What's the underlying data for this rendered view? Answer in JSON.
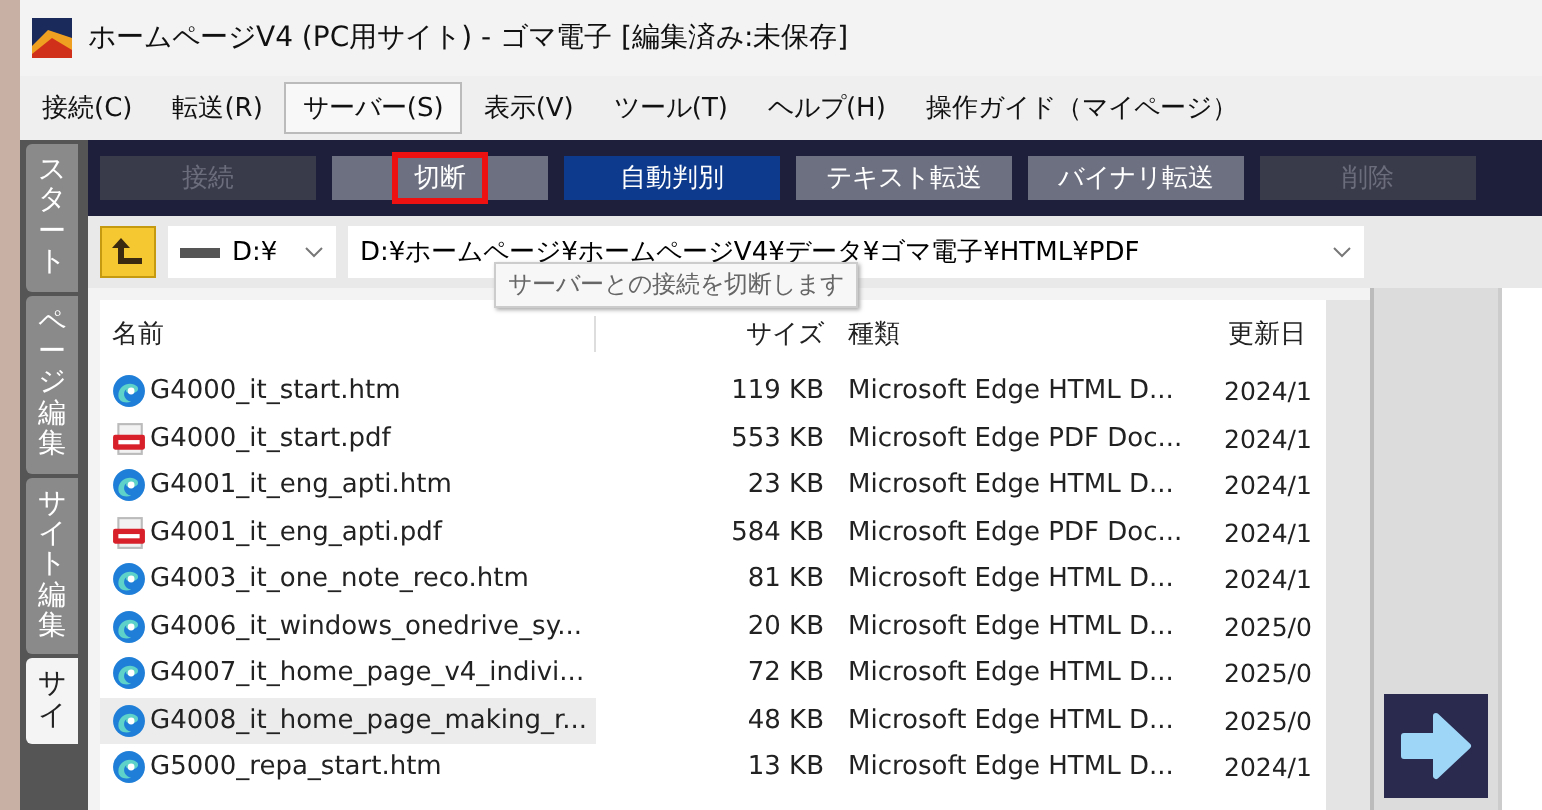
{
  "window": {
    "title": "ホームページV4 (PC用サイト) - ゴマ電子 [編集済み:未保存]"
  },
  "menu": [
    {
      "label": "接続(C)",
      "selected": false
    },
    {
      "label": "転送(R)",
      "selected": false
    },
    {
      "label": "サーバー(S)",
      "selected": true
    },
    {
      "label": "表示(V)",
      "selected": false
    },
    {
      "label": "ツール(T)",
      "selected": false
    },
    {
      "label": "ヘルプ(H)",
      "selected": false
    },
    {
      "label": "操作ガイド（マイページ）",
      "selected": false
    }
  ],
  "side_tabs": [
    {
      "label": "スタート",
      "selected": false
    },
    {
      "label": "ページ編集",
      "selected": false
    },
    {
      "label": "サイト編集",
      "selected": false
    },
    {
      "label": "サイ",
      "selected": true
    }
  ],
  "toolbar": [
    {
      "label": "接続",
      "disabled": true,
      "selected": false,
      "highlighted": false
    },
    {
      "label": "切断",
      "disabled": false,
      "selected": false,
      "highlighted": true
    },
    {
      "label": "自動判別",
      "disabled": false,
      "selected": true,
      "highlighted": false
    },
    {
      "label": "テキスト転送",
      "disabled": false,
      "selected": false,
      "highlighted": false
    },
    {
      "label": "バイナリ転送",
      "disabled": false,
      "selected": false,
      "highlighted": false
    },
    {
      "label": "削除",
      "disabled": true,
      "selected": false,
      "highlighted": false
    }
  ],
  "drive": {
    "value": "D:¥"
  },
  "path": {
    "value": "D:¥ホームページ¥ホームページV4¥データ¥ゴマ電子¥HTML¥PDF"
  },
  "tooltip": "サーバーとの接続を切断します",
  "table": {
    "columns": [
      "名前",
      "サイズ",
      "種類",
      "更新日"
    ],
    "rows": [
      {
        "kind": "edge",
        "name": "G4000_it_start.htm",
        "size": "119 KB",
        "type": "Microsoft Edge HTML D...",
        "date": "2024/1",
        "selected": false
      },
      {
        "kind": "pdf",
        "name": "G4000_it_start.pdf",
        "size": "553 KB",
        "type": "Microsoft Edge PDF Doc...",
        "date": "2024/1",
        "selected": false
      },
      {
        "kind": "edge",
        "name": "G4001_it_eng_apti.htm",
        "size": "23 KB",
        "type": "Microsoft Edge HTML D...",
        "date": "2024/1",
        "selected": false
      },
      {
        "kind": "pdf",
        "name": "G4001_it_eng_apti.pdf",
        "size": "584 KB",
        "type": "Microsoft Edge PDF Doc...",
        "date": "2024/1",
        "selected": false
      },
      {
        "kind": "edge",
        "name": "G4003_it_one_note_reco.htm",
        "size": "81 KB",
        "type": "Microsoft Edge HTML D...",
        "date": "2024/1",
        "selected": false
      },
      {
        "kind": "edge",
        "name": "G4006_it_windows_onedrive_sy...",
        "size": "20 KB",
        "type": "Microsoft Edge HTML D...",
        "date": "2025/0",
        "selected": false
      },
      {
        "kind": "edge",
        "name": "G4007_it_home_page_v4_indivi...",
        "size": "72 KB",
        "type": "Microsoft Edge HTML D...",
        "date": "2025/0",
        "selected": false
      },
      {
        "kind": "edge",
        "name": "G4008_it_home_page_making_r...",
        "size": "48 KB",
        "type": "Microsoft Edge HTML D...",
        "date": "2025/0",
        "selected": true
      },
      {
        "kind": "edge",
        "name": "G5000_repa_start.htm",
        "size": "13 KB",
        "type": "Microsoft Edge HTML D...",
        "date": "2024/1",
        "selected": false
      }
    ]
  }
}
